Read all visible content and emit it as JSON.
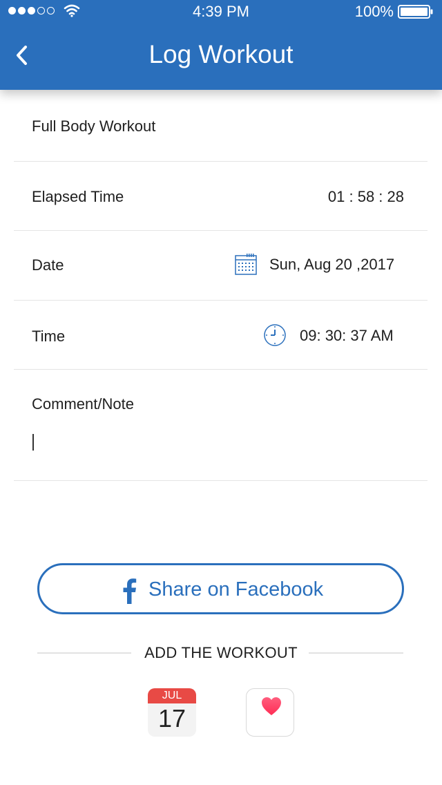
{
  "status_bar": {
    "time": "4:39 PM",
    "battery": "100%",
    "signal_bars_filled": 3,
    "signal_bars_total": 5
  },
  "header": {
    "title": "Log Workout",
    "back_icon": "chevron-left-icon"
  },
  "workout": {
    "name": "Full Body Workout"
  },
  "elapsed": {
    "label": "Elapsed  Time",
    "value": "01 : 58 : 28"
  },
  "date": {
    "label": "Date",
    "value": "Sun, Aug  20 ,2017",
    "icon": "calendar-icon"
  },
  "time": {
    "label": "Time",
    "value": "09: 30: 37 AM",
    "icon": "clock-icon"
  },
  "comment": {
    "label": "Comment/Note",
    "value": ""
  },
  "facebook": {
    "label": "Share on Facebook",
    "icon": "facebook-icon"
  },
  "add_workout": {
    "heading": "ADD THE WORKOUT",
    "calendar": {
      "month": "JUL",
      "day": "17"
    },
    "health_icon": "heart-icon"
  },
  "colors": {
    "primary": "#2a6fbc",
    "calendar_red": "#e84a45",
    "heart": "#ff2d55"
  }
}
